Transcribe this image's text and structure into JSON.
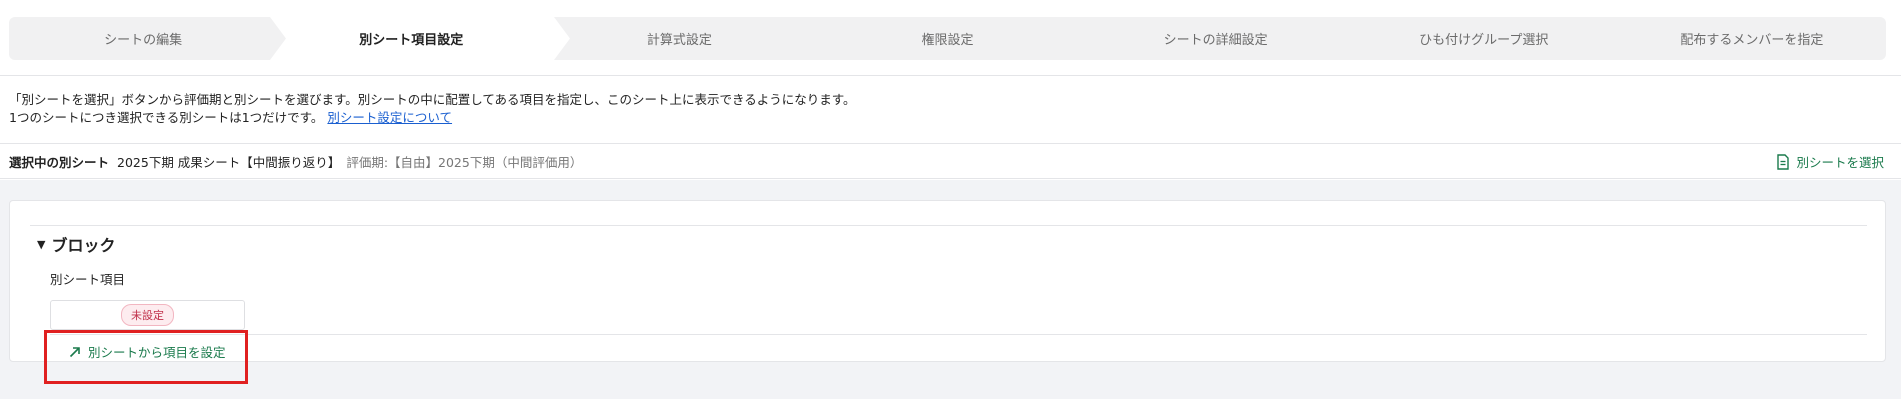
{
  "stepper": {
    "steps": [
      {
        "label": "シートの編集",
        "active": false
      },
      {
        "label": "別シート項目設定",
        "active": true
      },
      {
        "label": "計算式設定",
        "active": false
      },
      {
        "label": "権限設定",
        "active": false
      },
      {
        "label": "シートの詳細設定",
        "active": false
      },
      {
        "label": "ひも付けグループ選択",
        "active": false
      },
      {
        "label": "配布するメンバーを指定",
        "active": false
      }
    ]
  },
  "description": {
    "line1": "「別シートを選択」ボタンから評価期と別シートを選びます。別シートの中に配置してある項目を指定し、このシート上に表示できるようになります。",
    "line2": "1つのシートにつき選択できる別シートは1つだけです。",
    "link": "別シート設定について"
  },
  "selected": {
    "label": "選択中の別シート",
    "sheet_name": "2025下期 成果シート【中間振り返り】",
    "period": "評価期:【自由】2025下期（中間評価用）",
    "select_button": "別シートを選択",
    "select_icon": "document-icon"
  },
  "block": {
    "title": "ブロック",
    "toggle_icon": "triangle-down-icon",
    "field_label": "別シート項目",
    "status_badge": "未設定",
    "set_link": "別シートから項目を設定",
    "set_icon": "arrow-up-right-icon"
  },
  "colors": {
    "accent_green": "#1a7a4c",
    "link_blue": "#1a5fd0",
    "badge_red": "#c0304a",
    "highlight_red": "#e02020"
  }
}
